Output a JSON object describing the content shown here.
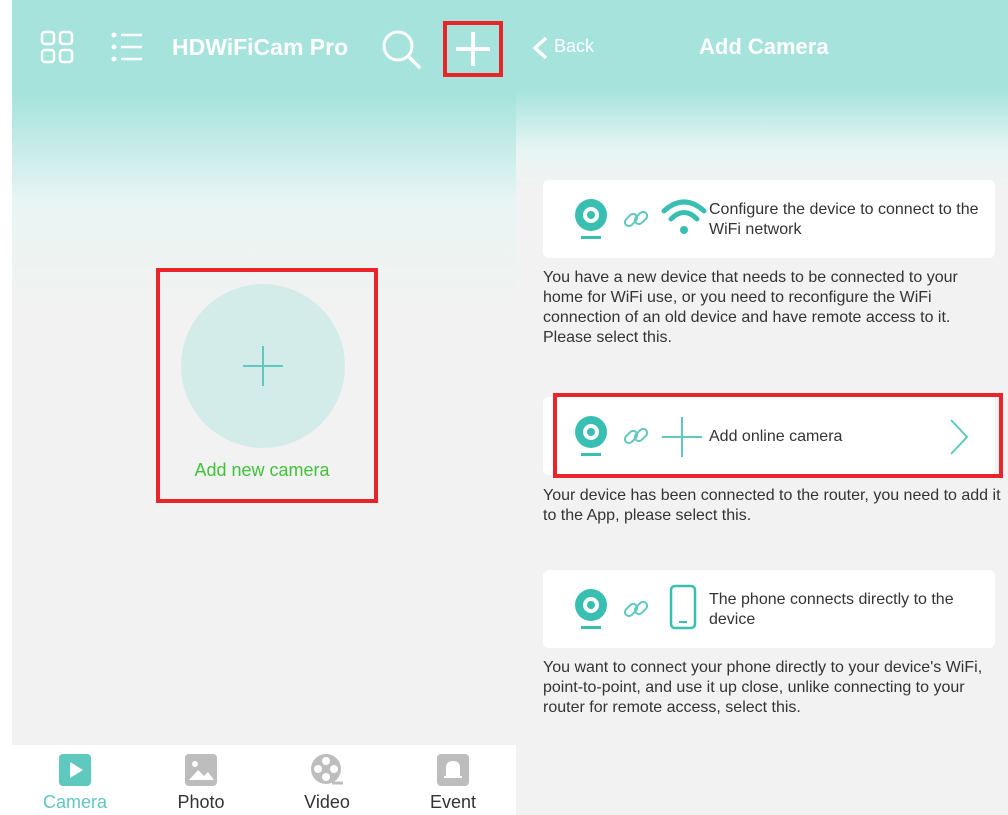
{
  "left_screen": {
    "header": {
      "title": "HDWiFiCam Pro",
      "icons": [
        "grid-icon",
        "list-icon",
        "search-icon",
        "plus-icon"
      ]
    },
    "add_new_camera_label": "Add new camera",
    "tabs": [
      {
        "label": "Camera",
        "icon": "play-icon",
        "active": true
      },
      {
        "label": "Photo",
        "icon": "image-icon",
        "active": false
      },
      {
        "label": "Video",
        "icon": "film-reel-icon",
        "active": false
      },
      {
        "label": "Event",
        "icon": "bell-icon",
        "active": false
      }
    ]
  },
  "right_screen": {
    "header": {
      "back_label": "Back",
      "title": "Add Camera"
    },
    "options": [
      {
        "label": "Configure the device to connect to the WiFi network",
        "description": "You have a new device that needs to be connected to your home for WiFi use, or you need to reconfigure the WiFi connection of an old device and have remote access to it. Please select this.",
        "icons": [
          "camera-icon",
          "link-icon",
          "wifi-icon"
        ]
      },
      {
        "label": "Add online camera",
        "description": "Your device has been connected to the router, you need to add it to the App, please select this.",
        "icons": [
          "camera-icon",
          "link-icon",
          "plus-icon",
          "chevron-right-icon"
        ]
      },
      {
        "label": "The phone connects directly to the device",
        "description": "You want to connect your phone directly to your device's WiFi, point-to-point, and use it up close, unlike connecting to your router for remote access, select this.",
        "icons": [
          "camera-icon",
          "link-icon",
          "phone-icon"
        ]
      }
    ]
  },
  "colors": {
    "accent": "#5fc8bf",
    "header_bg": "#a6e3dd",
    "highlight": "#e8252b",
    "add_label_green": "#41c23a",
    "background": "#f2f2f2"
  }
}
